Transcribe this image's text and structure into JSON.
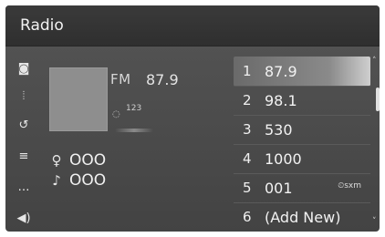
{
  "window": {
    "title": "Radio"
  },
  "sidebar": {
    "items": [
      {
        "icon": "source-select-icon",
        "glyph": "◙"
      },
      {
        "icon": "station-list-icon",
        "glyph": "⦙"
      },
      {
        "icon": "history-icon",
        "glyph": "↺"
      },
      {
        "icon": "playlist-icon",
        "glyph": "≡"
      },
      {
        "icon": "more-options-icon",
        "glyph": "…"
      },
      {
        "icon": "sound-settings-icon",
        "glyph": "◀)"
      }
    ]
  },
  "now_playing": {
    "band": "FM",
    "frequency": "87.9",
    "hd_glyph": "◌",
    "hd_channels": "123",
    "artist_glyph": "♀",
    "artist": "OOO",
    "song_glyph": "♪",
    "song": "OOO"
  },
  "presets": [
    {
      "num": "1",
      "value": "87.9",
      "selected": true
    },
    {
      "num": "2",
      "value": "98.1"
    },
    {
      "num": "3",
      "value": "530"
    },
    {
      "num": "4",
      "value": "1000"
    },
    {
      "num": "5",
      "value": "001",
      "tag": "⏲sxm"
    },
    {
      "num": "6",
      "value": "(Add New)"
    }
  ],
  "scroll": {
    "up_glyph": "˄",
    "down_glyph": "˅"
  }
}
